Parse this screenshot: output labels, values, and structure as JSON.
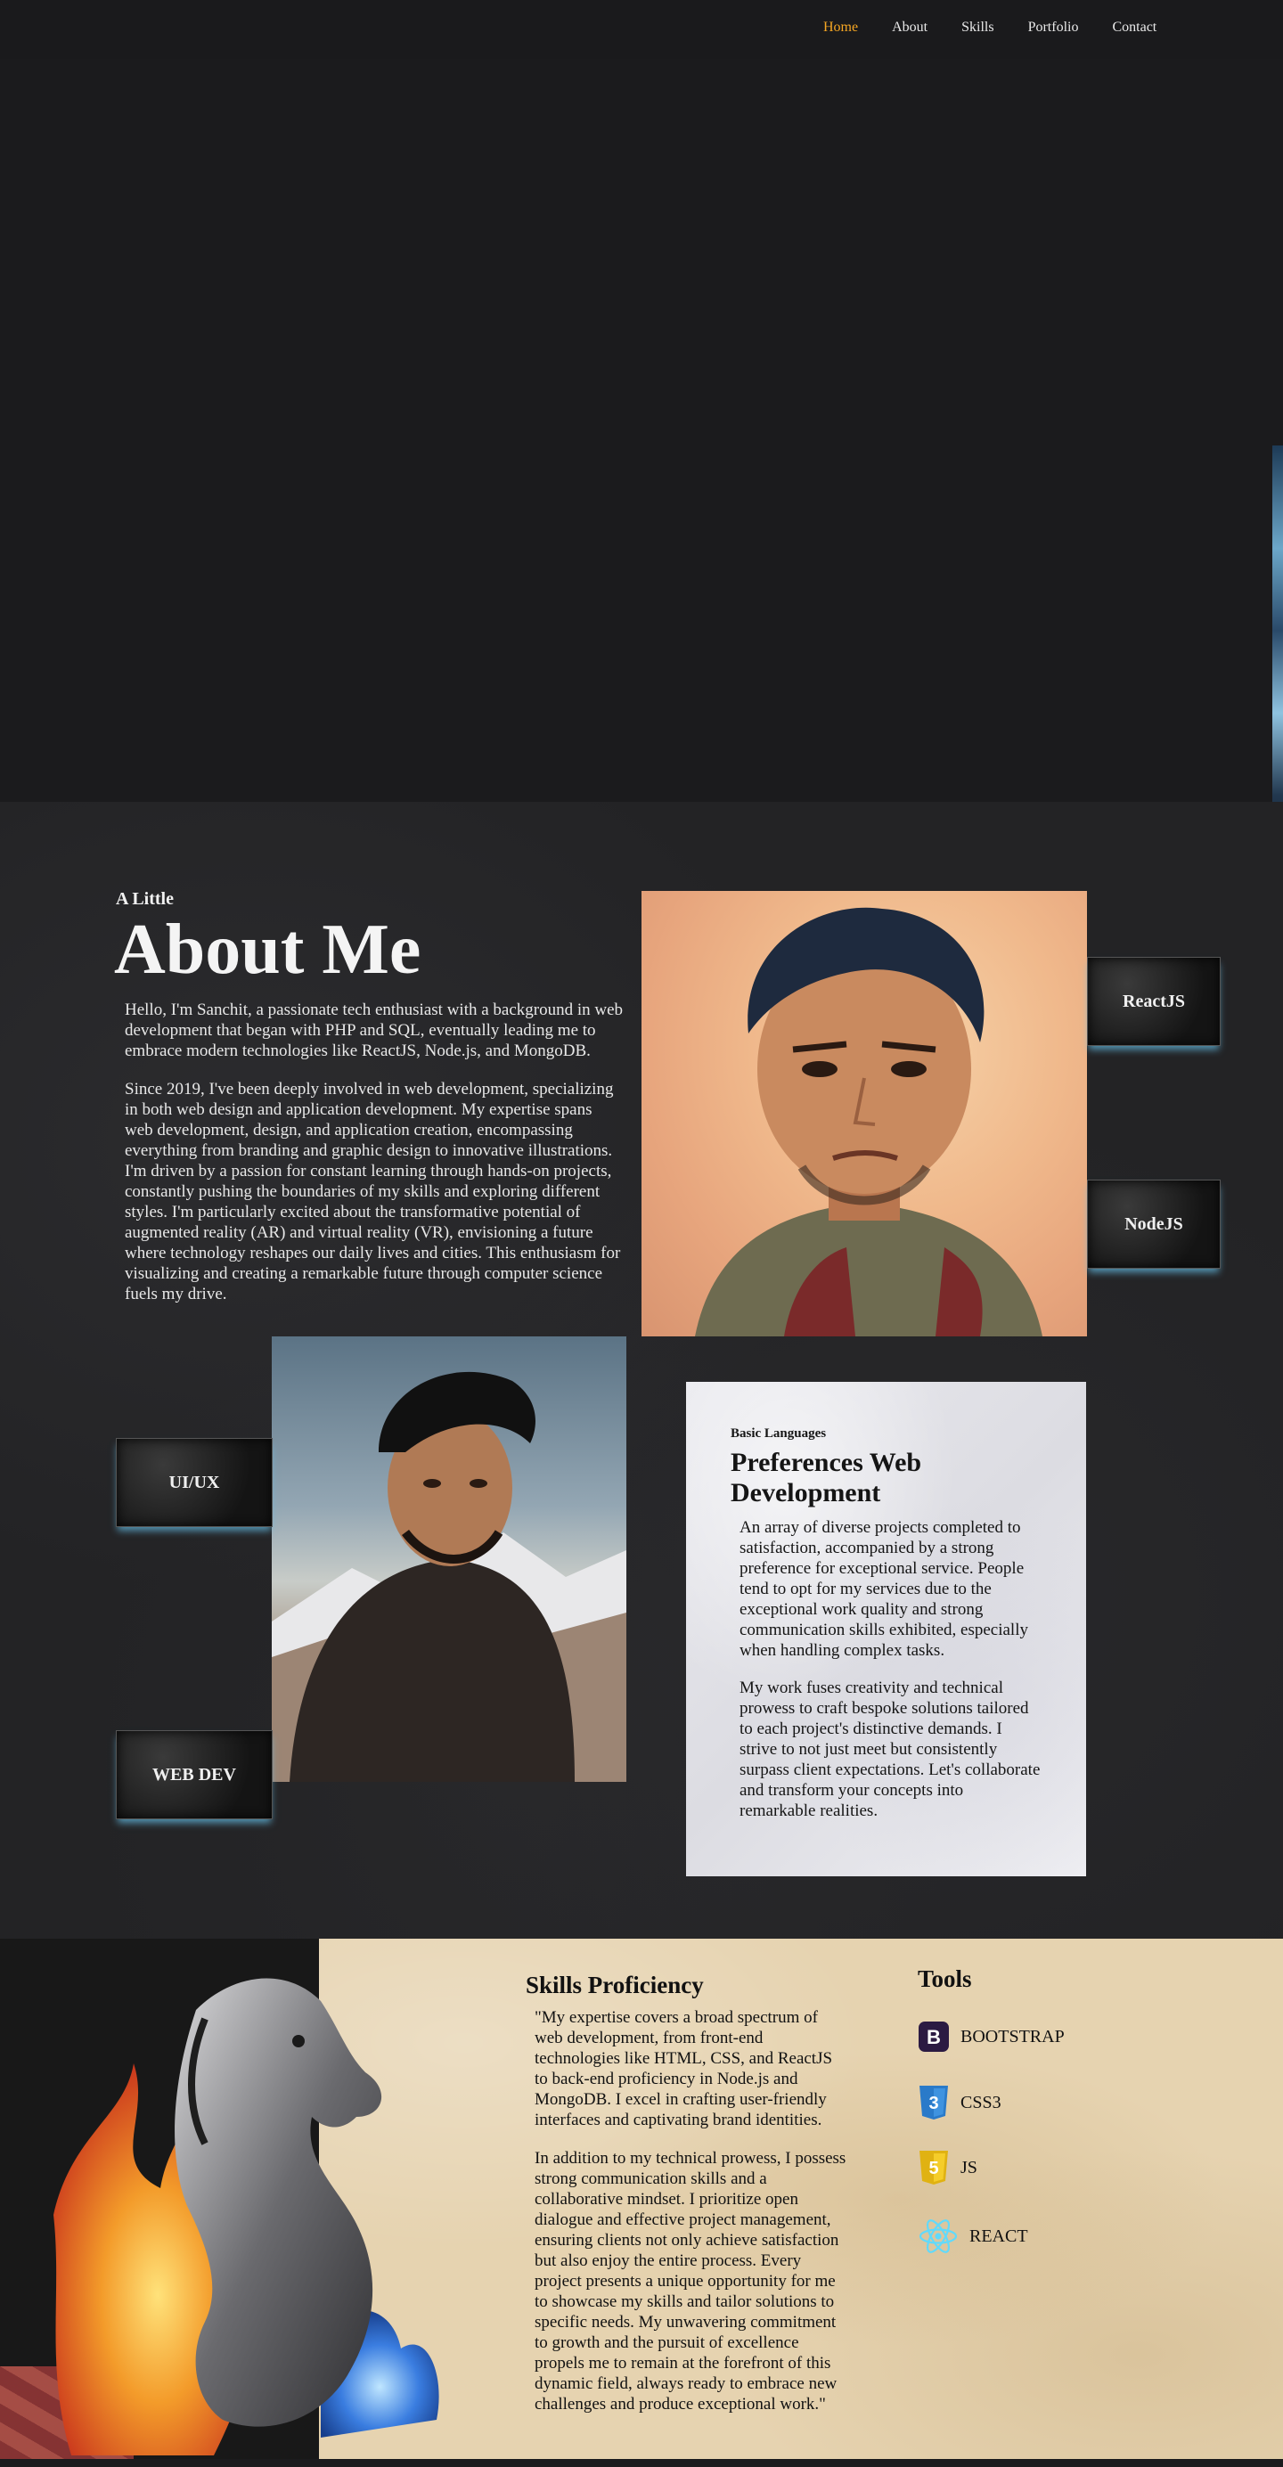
{
  "nav": {
    "items": [
      {
        "label": "Home",
        "active": true
      },
      {
        "label": "About",
        "active": false
      },
      {
        "label": "Skills",
        "active": false
      },
      {
        "label": "Portfolio",
        "active": false
      },
      {
        "label": "Contact",
        "active": false
      }
    ],
    "active_color": "#f5a623"
  },
  "about": {
    "kicker": "A Little",
    "title": "About Me",
    "paragraphs": [
      "Hello, I'm Sanchit, a passionate tech enthusiast with a background in web development that began with PHP and SQL, eventually leading me to embrace modern technologies like ReactJS, Node.js, and MongoDB.",
      "Since 2019, I've been deeply involved in web development, specializing in both web design and application development. My expertise spans web development, design, and application creation, encompassing everything from branding and graphic design to innovative illustrations. I'm driven by a passion for constant learning through hands-on projects, constantly pushing the boundaries of my skills and exploring different styles. I'm particularly excited about the transformative potential of augmented reality (AR) and virtual reality (VR), envisioning a future where technology reshapes our daily lives and cities. This enthusiasm for visualizing and creating a remarkable future through computer science fuels my drive."
    ],
    "tags": {
      "react": "ReactJS",
      "node": "NodeJS",
      "uiux": "UI/UX",
      "webdev": "WEB DEV"
    }
  },
  "preferences": {
    "kicker": "Basic Languages",
    "title": "Preferences Web Development",
    "paragraphs": [
      "An array of diverse projects completed to satisfaction, accompanied by a strong preference for exceptional service. People tend to opt for my services due to the exceptional work quality and strong communication skills exhibited, especially when handling complex tasks.",
      "My work fuses creativity and technical prowess to craft bespoke solutions tailored to each project's distinctive demands. I strive to not just meet but consistently surpass client expectations. Let's collaborate and transform your concepts into remarkable realities."
    ]
  },
  "skills": {
    "title": "Skills Proficiency",
    "paragraphs": [
      "\"My expertise covers a broad spectrum of web development, from front-end technologies like HTML, CSS, and ReactJS to back-end proficiency in Node.js and MongoDB. I excel in crafting user-friendly interfaces and captivating brand identities.",
      "In addition to my technical prowess, I possess strong communication skills and a collaborative mindset. I prioritize open dialogue and effective project management, ensuring clients not only achieve satisfaction but also enjoy the entire process. Every project presents a unique opportunity for me to showcase my skills and tailor solutions to specific needs. My unwavering commitment to growth and the pursuit of excellence propels me to remain at the forefront of this dynamic field, always ready to embrace new challenges and produce exceptional work.\""
    ]
  },
  "tools": {
    "title": "Tools",
    "items": [
      {
        "label": "BOOTSTRAP",
        "icon": "bootstrap-icon",
        "color": "#2b1a42"
      },
      {
        "label": "CSS3",
        "icon": "css3-icon",
        "color": "#2a7ac9"
      },
      {
        "label": "JS",
        "icon": "js-icon",
        "color": "#f0c419"
      },
      {
        "label": "REACT",
        "icon": "react-icon",
        "color": "#61dafb"
      }
    ]
  }
}
